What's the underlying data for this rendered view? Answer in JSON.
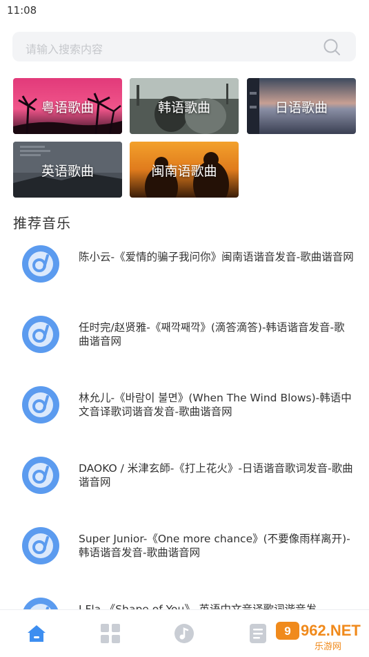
{
  "status": {
    "time": "11:08"
  },
  "search": {
    "placeholder": "请输入搜索内容"
  },
  "categories": [
    {
      "label": "粤语歌曲"
    },
    {
      "label": "韩语歌曲"
    },
    {
      "label": "日语歌曲"
    },
    {
      "label": "英语歌曲"
    },
    {
      "label": "闽南语歌曲"
    }
  ],
  "section": {
    "title": "推荐音乐"
  },
  "songs": [
    {
      "title": "陈小云-《爱情的骗子我问你》闽南语谐音发音-歌曲谐音网"
    },
    {
      "title": "任时完/赵贤雅-《째깍째깍》(滴答滴答)-韩语谐音发音-歌曲谐音网"
    },
    {
      "title": "林允儿-《바람이 불면》(When The Wind Blows)-韩语中文音译歌词谐音发音-歌曲谐音网"
    },
    {
      "title": "DAOKO / 米津玄師-《打上花火》-日语谐音歌词发音-歌曲谐音网"
    },
    {
      "title": "Super Junior-《One more chance》(不要像雨样离开)-韩语谐音发音-歌曲谐音网"
    },
    {
      "title": "J.Fla-《Shape of You》-英语中文音译歌词谐音发"
    }
  ],
  "nav": [
    {
      "icon": "home-icon"
    },
    {
      "icon": "grid-icon"
    },
    {
      "icon": "music-note-icon"
    },
    {
      "icon": "document-icon"
    }
  ],
  "watermark": {
    "text": "962.NET",
    "subtext": "乐游网"
  },
  "colors": {
    "accent": "#3d8ef0",
    "disc": "#5b9bef",
    "nav_inactive": "#c9cdd4"
  }
}
